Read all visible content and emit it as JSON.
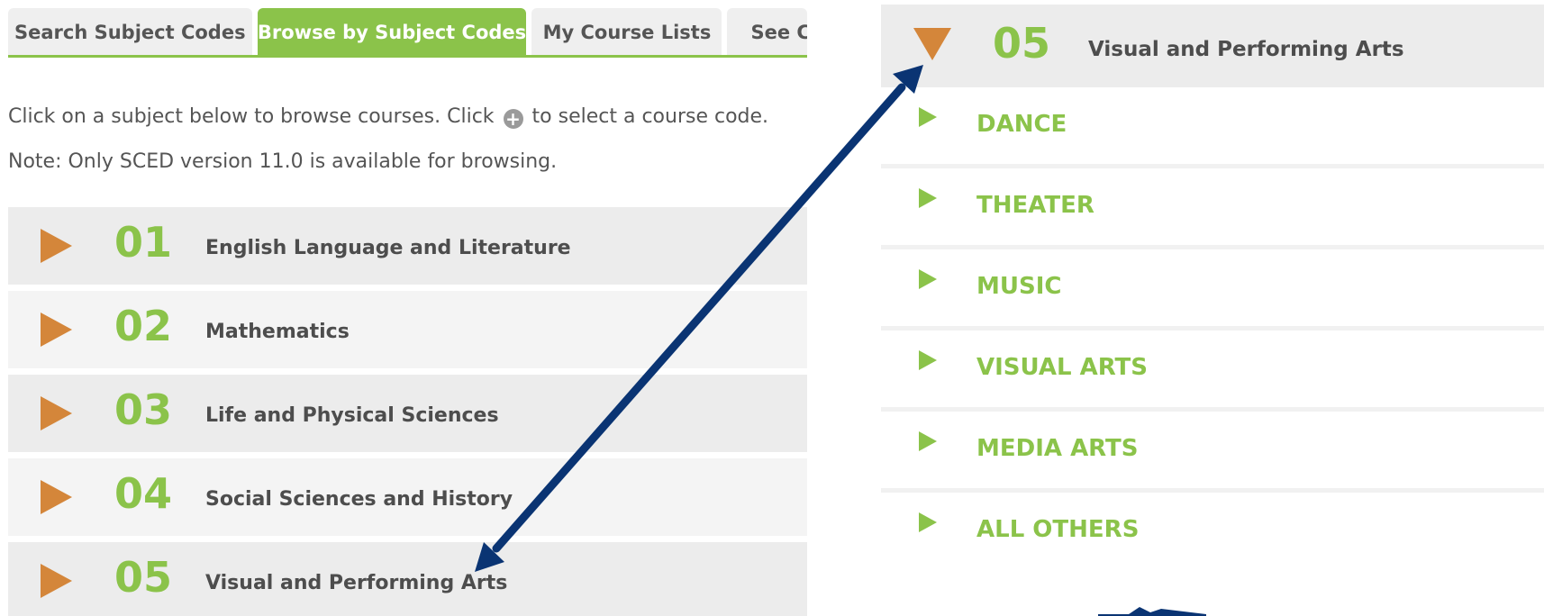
{
  "tabs": [
    {
      "label": "Search Subject Codes",
      "active": false
    },
    {
      "label": "Browse by Subject Codes",
      "active": true
    },
    {
      "label": "My Course Lists",
      "active": false
    },
    {
      "label": "See C",
      "active": false
    }
  ],
  "instructions": {
    "line1_before": "Click on a subject below to browse courses. Click",
    "line1_after": "to select a course code.",
    "plus_icon": "plus-circle-icon",
    "line2": "Note: Only SCED version 11.0 is available for browsing."
  },
  "subjects": [
    {
      "code": "01",
      "name": "English Language and Literature"
    },
    {
      "code": "02",
      "name": "Mathematics"
    },
    {
      "code": "03",
      "name": "Life and Physical Sciences"
    },
    {
      "code": "04",
      "name": "Social Sciences and History"
    },
    {
      "code": "05",
      "name": "Visual and Performing Arts"
    }
  ],
  "expanded": {
    "code": "05",
    "name": "Visual and Performing Arts",
    "subcategories": [
      "DANCE",
      "THEATER",
      "MUSIC",
      "VISUAL ARTS",
      "MEDIA ARTS",
      "ALL OTHERS"
    ]
  },
  "colors": {
    "accent_green": "#8bc34a",
    "triangle_orange": "#d4863a",
    "arrow_navy": "#0a3473",
    "row_gray": "#ececec"
  }
}
